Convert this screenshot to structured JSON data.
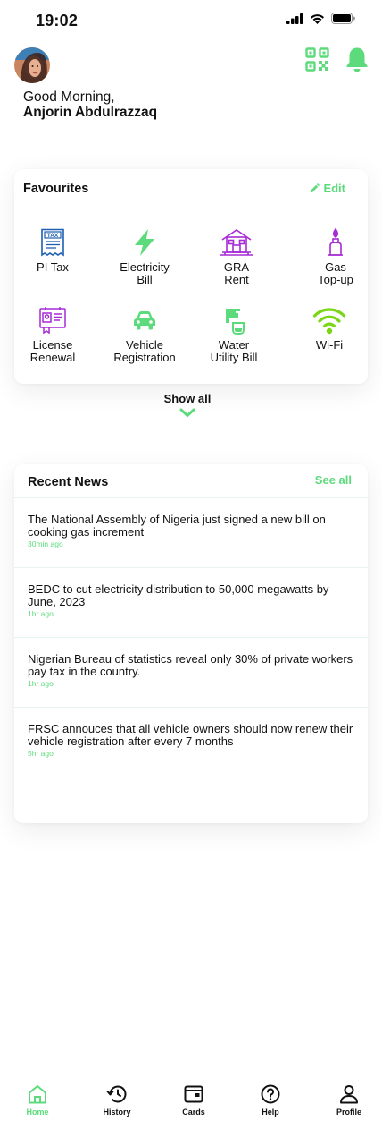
{
  "status_bar": {
    "time": "19:02"
  },
  "header": {
    "greeting": "Good Morning,",
    "user_name": "Anjorin Abdulrazzaq"
  },
  "favourites": {
    "title": "Favourites",
    "edit_label": "Edit",
    "items": [
      {
        "label": "PI Tax",
        "icon": "tax-document-icon"
      },
      {
        "label": "Electricity\nBill",
        "icon": "lightning-bolt-icon"
      },
      {
        "label": "GRA\nRent",
        "icon": "house-icon"
      },
      {
        "label": "Gas\nTop-up",
        "icon": "gas-cylinder-icon"
      },
      {
        "label": "License\nRenewal",
        "icon": "license-card-icon"
      },
      {
        "label": "Vehicle\nRegistration",
        "icon": "car-icon"
      },
      {
        "label": "Water\nUtility Bill",
        "icon": "water-tap-icon"
      },
      {
        "label": "Wi-Fi",
        "icon": "wifi-icon"
      }
    ],
    "show_all_label": "Show all"
  },
  "news": {
    "title": "Recent News",
    "see_all_label": "See all",
    "items": [
      {
        "text": "The National Assembly of Nigeria just signed a new bill on cooking gas increment",
        "time": "30min ago"
      },
      {
        "text": "BEDC to cut electricity distribution to 50,000 megawatts by June, 2023",
        "time": "1hr ago"
      },
      {
        "text": "Nigerian Bureau of statistics reveal only 30% of private workers pay tax in the country.",
        "time": "1hr ago"
      },
      {
        "text": "FRSC annouces that all vehicle owners should now renew their vehicle registration after every 7 months",
        "time": "5hr ago"
      }
    ]
  },
  "tabbar": {
    "tabs": [
      {
        "label": "Home",
        "icon": "home-icon",
        "active": true
      },
      {
        "label": "History",
        "icon": "history-icon",
        "active": false
      },
      {
        "label": "Cards",
        "icon": "cards-icon",
        "active": false
      },
      {
        "label": "Help",
        "icon": "help-icon",
        "active": false
      },
      {
        "label": "Profile",
        "icon": "profile-icon",
        "active": false
      }
    ]
  },
  "colors": {
    "accent": "#5ddb7c",
    "tax_blue": "#1f5fb0",
    "purple": "#a62bd6",
    "lime": "#7bd616"
  }
}
